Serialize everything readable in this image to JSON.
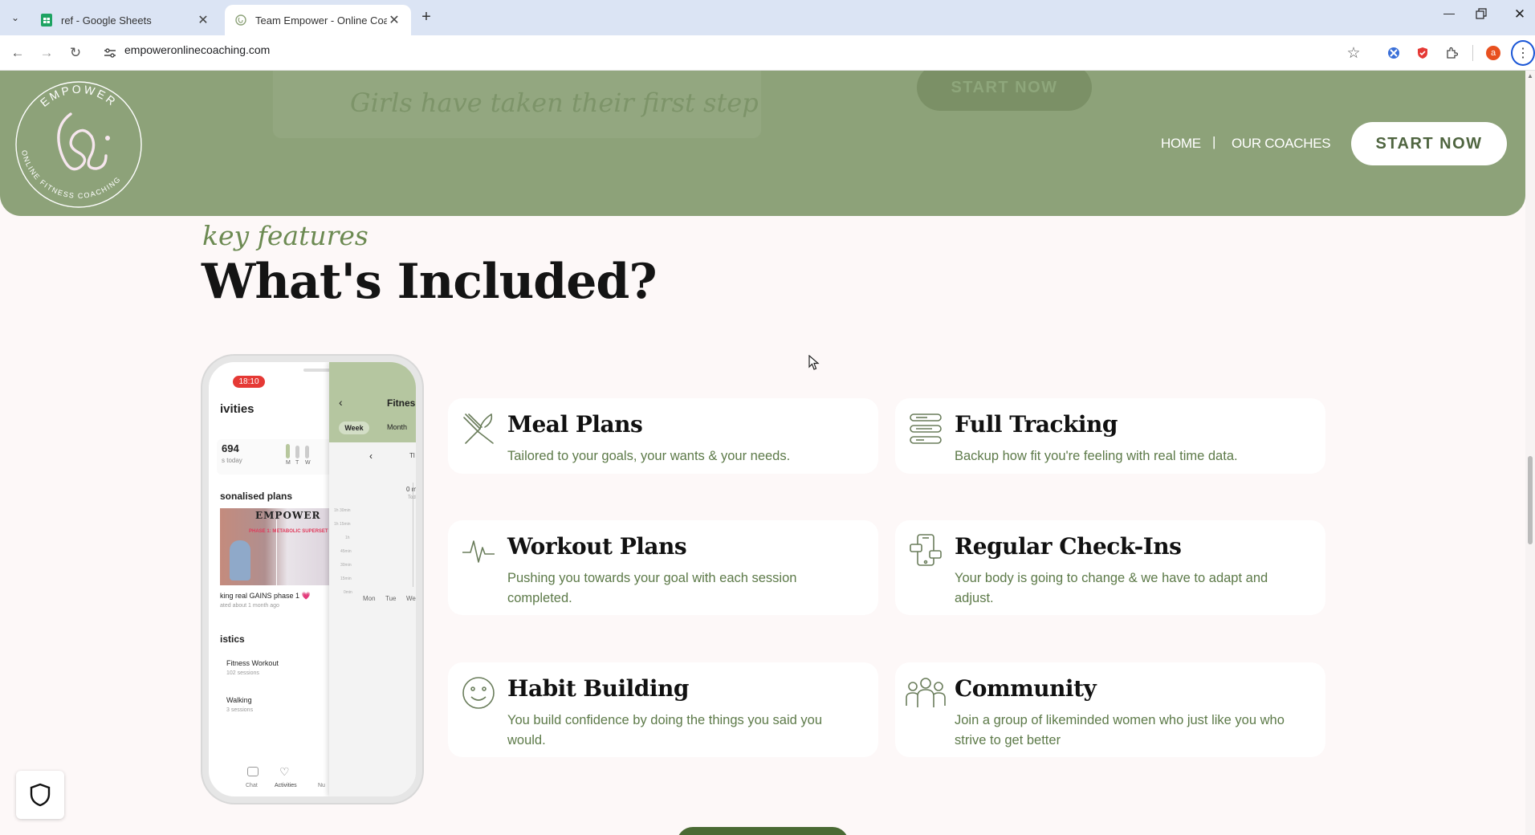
{
  "browser": {
    "tabs": [
      {
        "title": "ref - Google Sheets"
      },
      {
        "title": "Team Empower - Online Coachi"
      }
    ],
    "url": "empoweronlinecoaching.com",
    "profile_initial": "a"
  },
  "header": {
    "ghost_text": "Girls have taken their first step",
    "ghost_button": "START NOW",
    "logo_top": "EMPOWER",
    "logo_bottom": "ONLINE FITNESS COACHING",
    "nav": {
      "home": "HOME",
      "separator": "|",
      "coaches": "OUR COACHES"
    },
    "cta": "START NOW"
  },
  "section": {
    "kicker": "key features",
    "heading": "What's Included?"
  },
  "features": [
    {
      "icon": "fork-knife-icon",
      "title": "Meal Plans",
      "desc": "Tailored to your goals, your wants & your needs."
    },
    {
      "icon": "tracking-bars-icon",
      "title": "Full Tracking",
      "desc": "Backup how fit you're feeling with real time data."
    },
    {
      "icon": "heartbeat-icon",
      "title": "Workout Plans",
      "desc": "Pushing you towards your goal with each session completed."
    },
    {
      "icon": "phone-chat-icon",
      "title": "Regular Check-Ins",
      "desc": "Your body is going to change & we have to adapt and adjust."
    },
    {
      "icon": "smiley-icon",
      "title": "Habit Building",
      "desc": "You build confidence by doing the things you said you would."
    },
    {
      "icon": "people-icon",
      "title": "Community",
      "desc": "Join a group of likeminded women who just like you who strive to get better"
    }
  ],
  "phone": {
    "time": "18:10",
    "activities": "ivities",
    "steps": "694",
    "steps_sub": "s today",
    "days": [
      "M",
      "T",
      "W"
    ],
    "plans_heading": "sonalised plans",
    "plan_title": "king real GAINS phase 1 💗",
    "plan_sub": "ated about 1 month ago",
    "plan_banner": "EMPOWER",
    "plan_banner2": "PHASE 1: METABOLIC SUPERSET",
    "stats_heading": "istics",
    "stat1": "Fitness Workout",
    "stat1_sub": "102 sessions",
    "stat2": "Walking",
    "stat2_sub": "3 sessions",
    "overlay_title": "Fitnes",
    "overlay_tabs": [
      "Week",
      "Month"
    ],
    "overlay_yaxis": [
      "1h 30min",
      "1h 15min",
      "1h",
      "45min",
      "30min",
      "15min",
      "0min"
    ],
    "overlay_days": [
      "Mon",
      "Tue",
      "We"
    ],
    "overlay_value": "0 m",
    "overlay_value_sub": "Tod",
    "overlay_partial": "Tl",
    "bottom_nav": [
      "Chat",
      "Activities",
      "Nu"
    ]
  }
}
